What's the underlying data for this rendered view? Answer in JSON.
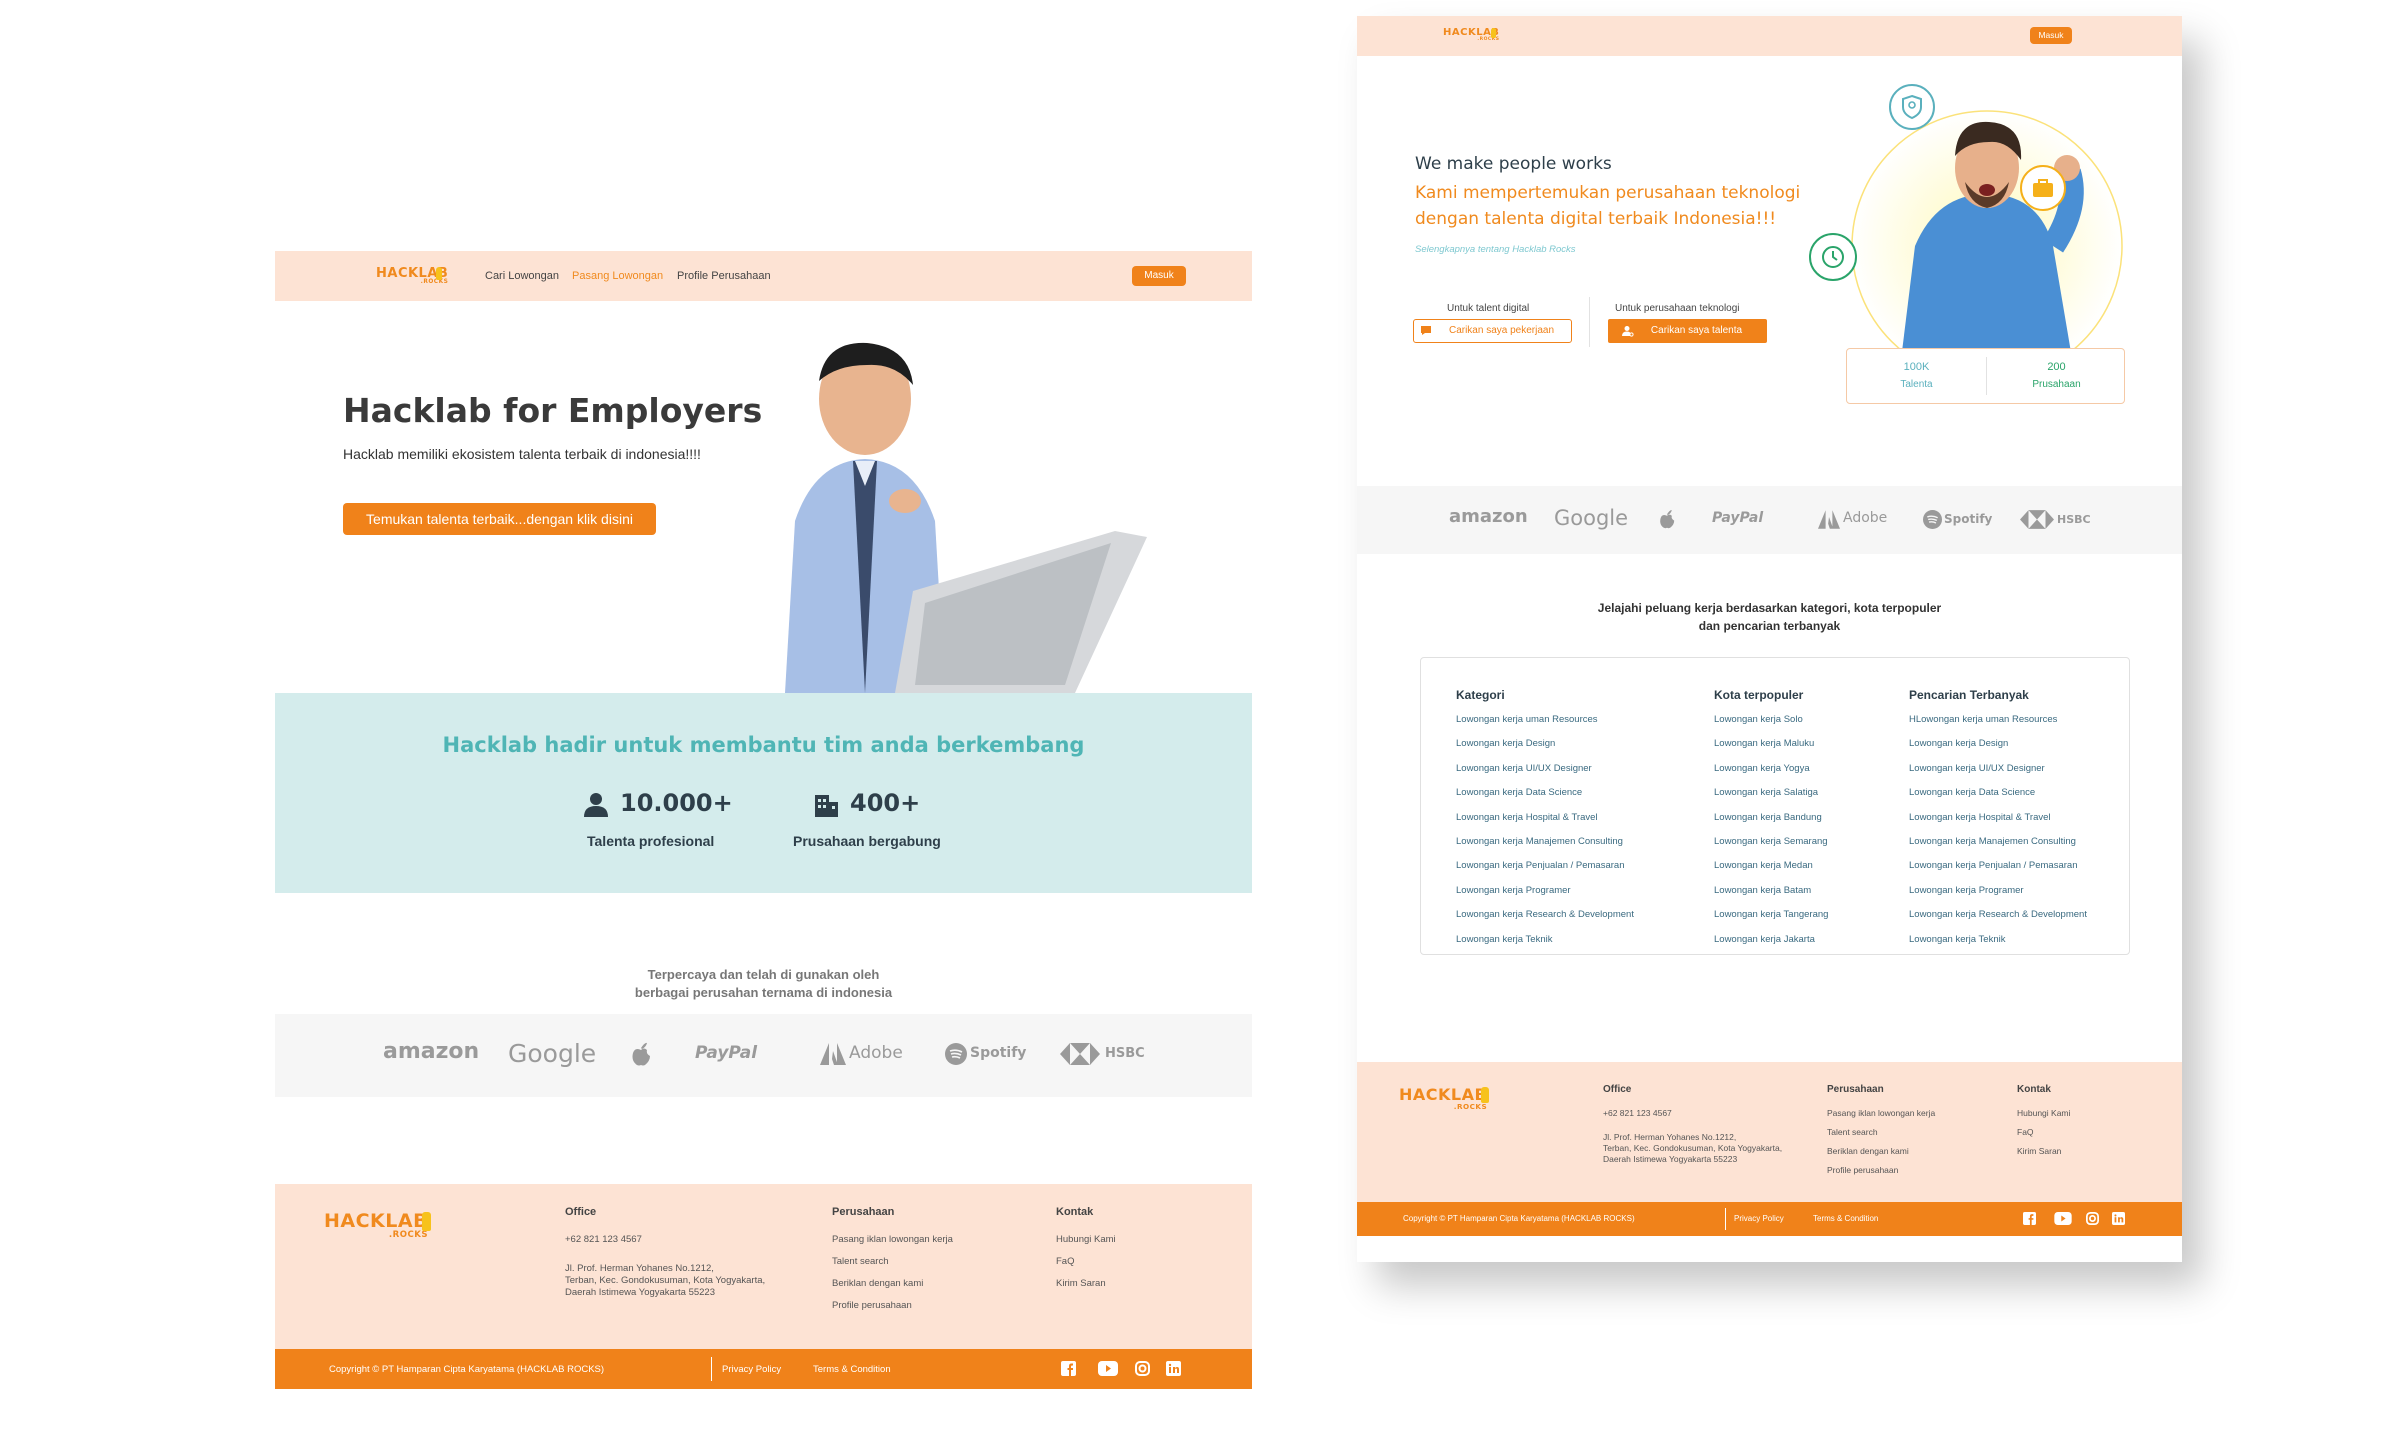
{
  "colors": {
    "accent": "#f0821a",
    "peach": "#fde3d4",
    "teal_band": "#d4ecec",
    "teal_text": "#4fb5b5",
    "dark": "#2e3f4a"
  },
  "logo": {
    "main": "HACKLAB",
    "sub": ".ROCKS"
  },
  "left": {
    "nav": {
      "links": [
        "Cari Lowongan",
        "Pasang Lowongan",
        "Profile Perusahaan"
      ],
      "login": "Masuk"
    },
    "hero": {
      "title": "Hacklab for Employers",
      "subtitle": "Hacklab memiliki ekosistem talenta terbaik di indonesia!!!!",
      "cta": "Temukan talenta terbaik...dengan klik disini"
    },
    "stats": {
      "title": "Hacklab hadir untuk membantu tim anda berkembang",
      "items": [
        {
          "icon": "person-icon",
          "value": "10.000+",
          "label": "Talenta profesional"
        },
        {
          "icon": "building-icon",
          "value": "400+",
          "label": "Prusahaan bergabung"
        }
      ]
    },
    "trusted": {
      "line1": "Terpercaya dan telah di gunakan oleh",
      "line2": "berbagai perusahan ternama di indonesia"
    }
  },
  "brands": [
    "amazon",
    "Google",
    "",
    "PayPal",
    "Adobe",
    "Spotify",
    "HSBC"
  ],
  "footer": {
    "office_head": "Office",
    "phone": "+62 821 123 4567",
    "address": [
      "Jl. Prof. Herman Yohanes No.1212,",
      "Terban, Kec. Gondokusuman, Kota Yogyakarta,",
      "Daerah Istimewa Yogyakarta 55223"
    ],
    "company_head": "Perusahaan",
    "company_links": [
      "Pasang iklan lowongan kerja",
      "Talent search",
      "Beriklan dengan kami",
      "Profile perusahaan"
    ],
    "contact_head": "Kontak",
    "contact_links": [
      "Hubungi Kami",
      "FaQ",
      "Kirim Saran"
    ],
    "copyright": "Copyright © PT Hamparan Cipta Karyatama (HACKLAB ROCKS)",
    "privacy": "Privacy Policy",
    "terms": "Terms & Condition",
    "social": [
      "facebook-icon",
      "youtube-icon",
      "instagram-icon",
      "linkedin-icon"
    ]
  },
  "right": {
    "nav": {
      "login": "Masuk"
    },
    "hero": {
      "tagline": "We make people works",
      "headline1": "Kami mempertemukan perusahaan teknologi",
      "headline2": "dengan talenta digital terbaik Indonesia!!!",
      "more_link": "Selengkapnya tentang Hacklab Rocks",
      "talent_label": "Untuk talent digital",
      "talent_button": "Carikan saya pekerjaan",
      "company_label": "Untuk perusahaan teknologi",
      "company_button": "Carikan saya talenta",
      "stat1_value": "100K",
      "stat1_label": "Talenta",
      "stat2_value": "200",
      "stat2_label": "Prusahaan"
    },
    "explore": {
      "line1": "Jelajahi peluang kerja berdasarkan kategori, kota terpopuler",
      "line2": "dan pencarian terbanyak"
    },
    "columns": [
      {
        "head": "Kategori",
        "items": [
          "Lowongan kerja uman Resources",
          "Lowongan kerja Design",
          "Lowongan kerja UI/UX Designer",
          "Lowongan kerja Data Science",
          "Lowongan kerja Hospital & Travel",
          "Lowongan kerja Manajemen Consulting",
          "Lowongan kerja Penjualan  / Pemasaran",
          "Lowongan kerja Programer",
          "Lowongan kerja Research & Development",
          "Lowongan kerja Teknik"
        ]
      },
      {
        "head": "Kota terpopuler",
        "items": [
          "Lowongan kerja Solo",
          "Lowongan kerja Maluku",
          "Lowongan kerja Yogya",
          "Lowongan kerja Salatiga",
          "Lowongan kerja Bandung",
          "Lowongan kerja Semarang",
          "Lowongan kerja Medan",
          "Lowongan kerja Batam",
          "Lowongan kerja Tangerang",
          "Lowongan kerja Jakarta"
        ]
      },
      {
        "head": "Pencarian Terbanyak",
        "items": [
          "HLowongan kerja uman Resources",
          "Lowongan kerja Design",
          "Lowongan kerja UI/UX Designer",
          "Lowongan kerja Data Science",
          "Lowongan kerja Hospital & Travel",
          "Lowongan kerja Manajemen Consulting",
          "Lowongan kerja Penjualan  / Pemasaran",
          "Lowongan kerja Programer",
          "Lowongan kerja Research & Development",
          "Lowongan kerja Teknik"
        ]
      }
    ]
  }
}
